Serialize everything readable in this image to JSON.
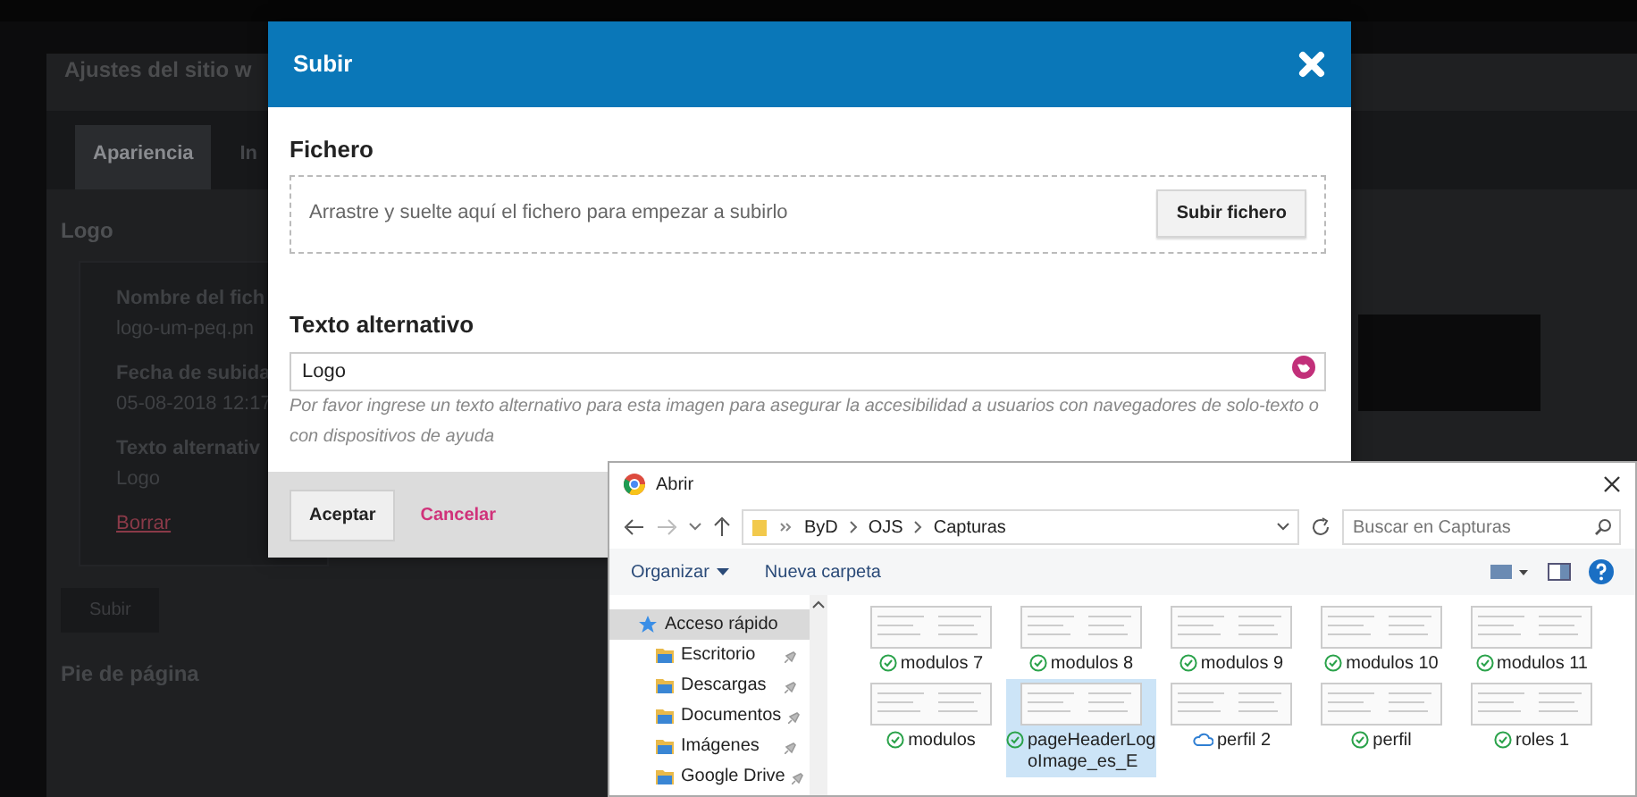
{
  "background_page": {
    "title": "Ajustes del sitio w",
    "tabs": [
      {
        "label": "Apariencia",
        "selected": true
      },
      {
        "label": "In",
        "selected": false
      }
    ],
    "section_title": "Logo",
    "logo_fields": [
      {
        "label": "Nombre del fich",
        "value": "logo-um-peq.pn"
      },
      {
        "label": "Fecha de subida",
        "value": "05-08-2018 12:17"
      },
      {
        "label": "Texto alternativ",
        "value": "Logo"
      }
    ],
    "delete_link": "Borrar",
    "upload_button": "Subir",
    "footer_section_title": "Pie de página"
  },
  "upload_modal": {
    "title": "Subir",
    "file_label": "Fichero",
    "dropzone_text": "Arrastre y suelte aquí el fichero para empezar a subirlo",
    "upload_file_button": "Subir fichero",
    "alt_label": "Texto alternativo",
    "alt_value": "Logo",
    "alt_help": "Por favor ingrese un texto alternativo para esta imagen para asegurar la accesibilidad a usuarios con navegadores de solo-texto o con dispositivos de ayuda",
    "buttons": [
      {
        "label": "Aceptar",
        "kind": "primary"
      },
      {
        "label": "Cancelar",
        "kind": "link"
      }
    ]
  },
  "open_dialog": {
    "title": "Abrir",
    "path": [
      "ByD",
      "OJS",
      "Capturas"
    ],
    "search": {
      "placeholder": "Buscar en Capturas"
    },
    "toolbar": [
      "Organizar",
      "Nueva carpeta"
    ],
    "sidebar": [
      {
        "label": "Acceso rápido",
        "kind": "quick-access",
        "selected": true,
        "pinned": false
      },
      {
        "label": "Escritorio",
        "kind": "folder",
        "selected": false,
        "pinned": true
      },
      {
        "label": "Descargas",
        "kind": "folder",
        "selected": false,
        "pinned": true
      },
      {
        "label": "Documentos",
        "kind": "folder",
        "selected": false,
        "pinned": true
      },
      {
        "label": "Imágenes",
        "kind": "folder",
        "selected": false,
        "pinned": true
      },
      {
        "label": "Google Drive",
        "kind": "folder",
        "selected": false,
        "pinned": true
      }
    ],
    "files": [
      {
        "name": "modulos 7",
        "kind": "synced",
        "selected": false
      },
      {
        "name": "modulos 8",
        "kind": "synced",
        "selected": false
      },
      {
        "name": "modulos 9",
        "kind": "synced",
        "selected": false
      },
      {
        "name": "modulos 10",
        "kind": "synced",
        "selected": false
      },
      {
        "name": "modulos 11",
        "kind": "synced",
        "selected": false
      },
      {
        "name": "modulos",
        "kind": "synced",
        "selected": false
      },
      {
        "name": "pageHeaderLogoImage_es_E",
        "kind": "synced",
        "selected": true
      },
      {
        "name": "perfil 2",
        "kind": "cloud",
        "selected": false
      },
      {
        "name": "perfil",
        "kind": "synced",
        "selected": false
      },
      {
        "name": "roles 1",
        "kind": "synced",
        "selected": false
      }
    ]
  }
}
